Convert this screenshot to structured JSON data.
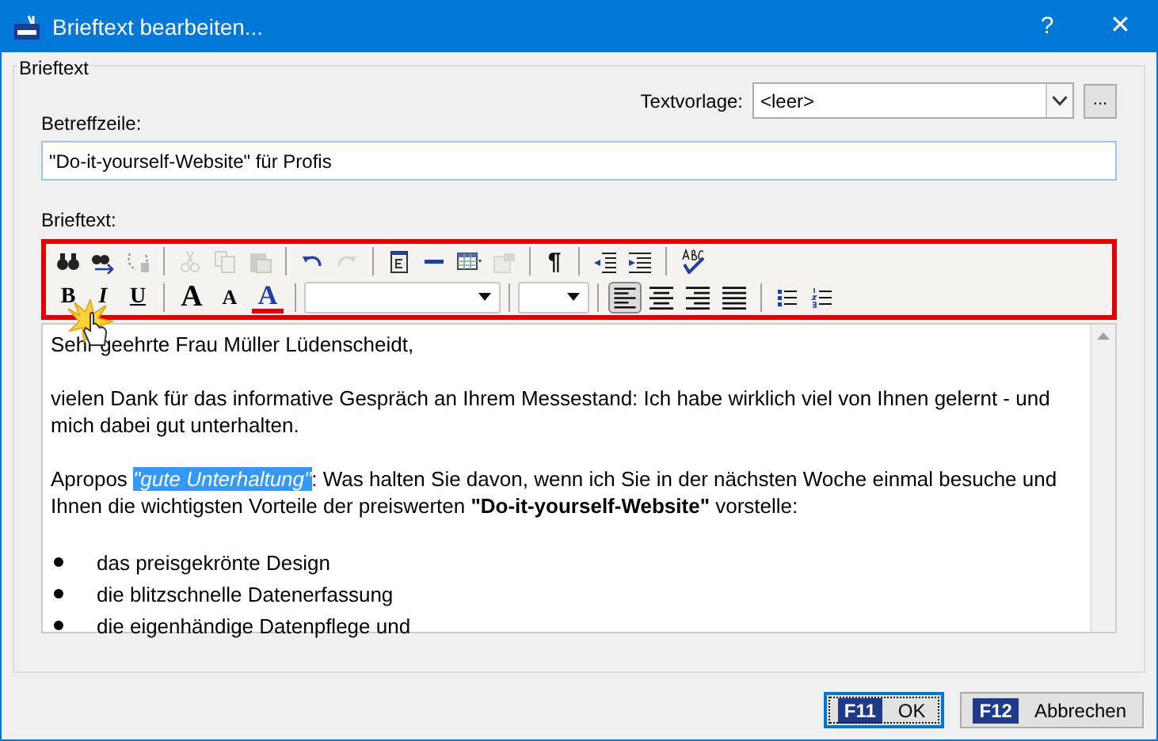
{
  "window": {
    "title": "Brieftext bearbeiten...",
    "help": "?",
    "close": "✕"
  },
  "group": {
    "title": "Brieftext"
  },
  "template": {
    "label": "Textvorlage:",
    "value": "<leer>",
    "more": "..."
  },
  "subject": {
    "label": "Betreffzeile:",
    "value": "\"Do-it-yourself-Website\" für Profis"
  },
  "editor_label": "Brieftext:",
  "toolbar_row1": [
    [
      {
        "disabled": false
      },
      {
        "disabled": false
      },
      {
        "disabled": false
      }
    ],
    [
      {
        "disabled": true
      },
      {
        "disabled": true
      },
      {
        "disabled": true
      }
    ],
    [
      {
        "disabled": false
      },
      {
        "disabled": true
      }
    ],
    [
      {
        "disabled": false
      },
      {
        "disabled": false
      },
      {
        "disabled": false
      },
      {
        "disabled": true
      }
    ],
    [
      {
        "disabled": false,
        "label": "¶"
      }
    ],
    [
      {
        "disabled": false
      },
      {
        "disabled": false
      }
    ],
    [
      {
        "disabled": false
      }
    ]
  ],
  "format_buttons": [
    {
      "label": "B",
      "kind": "bold"
    },
    {
      "label": "I",
      "kind": "italic"
    },
    {
      "label": "U",
      "kind": "underline"
    }
  ],
  "size_buttons": [
    {
      "label": "A",
      "kind": "grow"
    },
    {
      "label": "A",
      "kind": "shrink"
    },
    {
      "label": "A",
      "kind": "color"
    }
  ],
  "align_buttons": [
    {
      "selected": true
    },
    {
      "selected": false
    },
    {
      "selected": false
    },
    {
      "selected": false
    }
  ],
  "list_buttons": [
    {
      "kind": "bullets"
    },
    {
      "kind": "numbered"
    }
  ],
  "paragraphs": [
    [
      {
        "text": "Sehr geehrte Frau Müller Lüdenscheidt,",
        "selected": false
      }
    ],
    [
      {
        "text": "vielen Dank für das informative Gespräch an Ihrem Messestand: Ich habe wirklich viel von Ihnen gelernt - und mich dabei gut unterhalten.",
        "selected": false
      }
    ],
    [
      {
        "text": "Apropos ",
        "selected": false
      },
      {
        "text": "*\"gute Unterhaltung\"*",
        "selected": true
      },
      {
        "text": ": Was halten Sie davon, wenn ich Sie in der nächsten Woche einmal besuche und Ihnen die wichtigsten Vorteile der preiswerten **\"Do-it-yourself-Website\"** vorstelle:",
        "selected": false
      }
    ]
  ],
  "bullets": [
    "das preisgekrönte Design",
    "die blitzschnelle Datenerfassung",
    "die eigenhändige Datenpflege und"
  ],
  "buttons": [
    {
      "key": "F11",
      "label": "OK",
      "default": true
    },
    {
      "key": "F12",
      "label": "Abbrechen",
      "default": false
    }
  ]
}
